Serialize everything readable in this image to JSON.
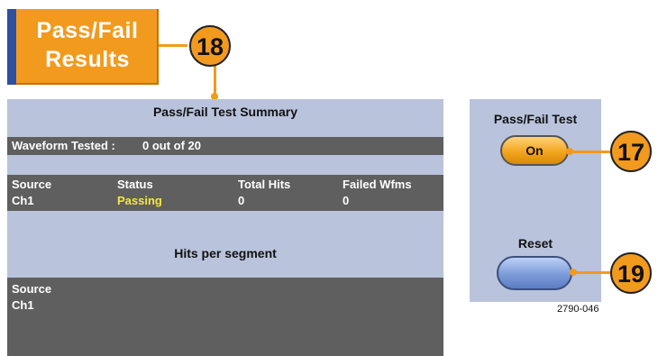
{
  "header": {
    "button_line1": "Pass/Fail",
    "button_line2": "Results"
  },
  "callouts": {
    "results": "18",
    "test": "17",
    "reset": "19"
  },
  "summary": {
    "title": "Pass/Fail Test Summary",
    "tested_label": "Waveform Tested :",
    "tested_value": "0 out of 20",
    "columns": [
      "Source",
      "Status",
      "Total Hits",
      "Failed Wfms"
    ],
    "row": {
      "source": "Ch1",
      "status": "Passing",
      "total_hits": "0",
      "failed_wfms": "0"
    }
  },
  "segments": {
    "title": "Hits per segment",
    "column": "Source",
    "row_source": "Ch1"
  },
  "side": {
    "test_label": "Pass/Fail Test",
    "test_button": "On",
    "reset_label": "Reset"
  },
  "figure_id": "2790-046",
  "colors": {
    "accent": "#f29a1e",
    "panel": "#b9c3dc",
    "bar": "#5f5f5f",
    "status_passing": "#f5e73c"
  }
}
